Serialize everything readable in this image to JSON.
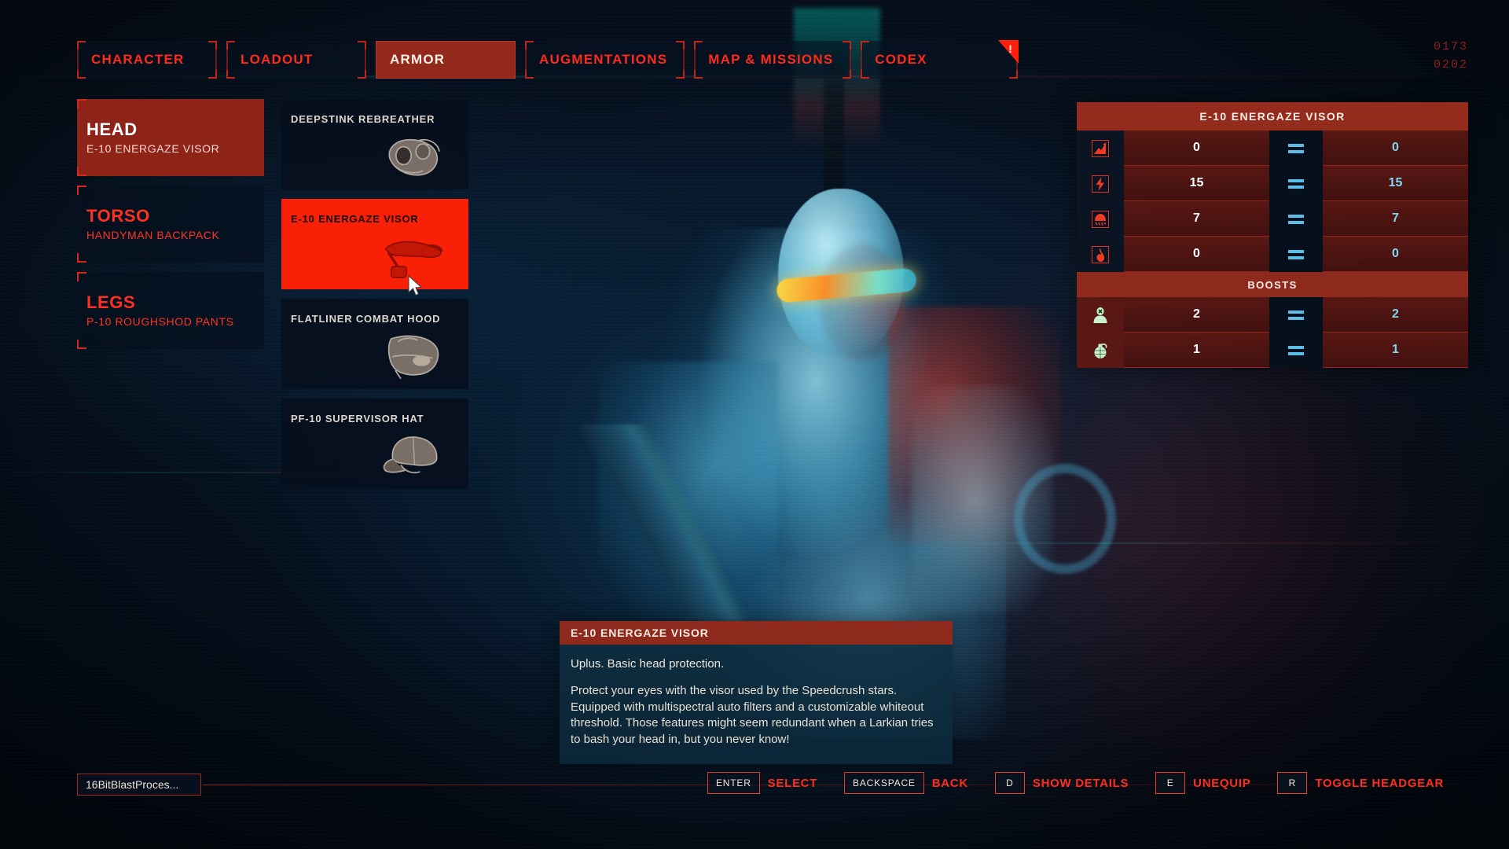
{
  "header": {
    "tabs": [
      {
        "label": "CHARACTER",
        "active": false
      },
      {
        "label": "LOADOUT",
        "active": false
      },
      {
        "label": "ARMOR",
        "active": true
      },
      {
        "label": "AUGMENTATIONS",
        "active": false
      },
      {
        "label": "MAP & MISSIONS",
        "active": false
      },
      {
        "label": "CODEX",
        "active": false,
        "badge": "!"
      }
    ],
    "counter_top": "0173",
    "counter_bottom": "0202"
  },
  "slots": [
    {
      "name": "HEAD",
      "item": "E-10 ENERGAZE VISOR",
      "active": true
    },
    {
      "name": "TORSO",
      "item": "HANDYMAN BACKPACK",
      "active": false
    },
    {
      "name": "LEGS",
      "item": "P-10 ROUGHSHOD PANTS",
      "active": false
    }
  ],
  "items": [
    {
      "title": "DEEPSTINK REBREATHER",
      "icon": "rebreather-icon",
      "selected": false
    },
    {
      "title": "E-10 ENERGAZE VISOR",
      "icon": "visor-icon",
      "selected": true
    },
    {
      "title": "FLATLINER COMBAT HOOD",
      "icon": "combat-hood-icon",
      "selected": false
    },
    {
      "title": "PF-10 SUPERVISOR HAT",
      "icon": "cap-icon",
      "selected": false
    }
  ],
  "stats_panel": {
    "title": "E-10 ENERGAZE VISOR",
    "rows": [
      {
        "icon": "ballistic-icon",
        "current": "0",
        "compare": "=",
        "equipped": "0"
      },
      {
        "icon": "electric-icon",
        "current": "15",
        "compare": "=",
        "equipped": "15"
      },
      {
        "icon": "toxic-icon",
        "current": "7",
        "compare": "=",
        "equipped": "7"
      },
      {
        "icon": "fire-icon",
        "current": "0",
        "compare": "=",
        "equipped": "0"
      }
    ],
    "boosts_label": "BOOSTS",
    "boosts": [
      {
        "icon": "anti-personnel-icon",
        "current": "2",
        "compare": "=",
        "equipped": "2"
      },
      {
        "icon": "grenade-icon",
        "current": "1",
        "compare": "=",
        "equipped": "1"
      }
    ]
  },
  "tooltip": {
    "title": "E-10 ENERGAZE VISOR",
    "summary": "Uplus. Basic head protection.",
    "description": "Protect your eyes with the visor used by the Speedcrush stars. Equipped with multispectral auto filters and a customizable whiteout threshold. Those features might seem redundant when a Larkian tries to bash your head in, but you never know!"
  },
  "footer": {
    "profile": "16BitBlastProces...",
    "hints": [
      {
        "key": "ENTER",
        "label": "SELECT"
      },
      {
        "key": "BACKSPACE",
        "label": "BACK"
      },
      {
        "key": "D",
        "label": "SHOW DETAILS"
      },
      {
        "key": "E",
        "label": "UNEQUIP"
      },
      {
        "key": "R",
        "label": "TOGGLE HEADGEAR"
      }
    ]
  },
  "colors": {
    "accent_red": "#ff2a1a",
    "selected_red": "#fa2008",
    "panel_red": "#8d2a1d",
    "compare_blue": "#7fd8ef",
    "boost_green": "#c8f2cd"
  }
}
